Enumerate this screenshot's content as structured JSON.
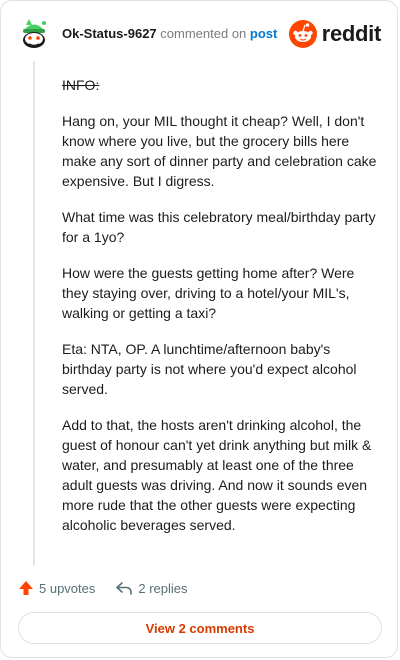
{
  "comment": {
    "author": "Ok-Status-9627",
    "action_text": "commented on",
    "post_link": "post",
    "avatar_icon": "snoo-avatar-icon",
    "brand_word": "reddit",
    "brand_color": "#ff4500",
    "paragraphs": [
      "INFO:",
      "Hang on, your MIL thought it cheap? Well, I don't know where you live, but the grocery bills here make any sort of dinner party and celebration cake expensive. But I digress.",
      "What time was this celebratory meal/birthday party for a 1yo?",
      "How were the guests getting home after? Were they staying over, driving to a hotel/your MIL's, walking or getting a taxi?",
      "Eta: NTA, OP. A lunchtime/afternoon baby's birthday party is not where you'd expect alcohol served.",
      "Add to that, the hosts aren't drinking alcohol, the guest of honour can't yet drink anything but milk & water, and presumably at least one of the three adult guests was driving. And now it sounds even more rude that the other guests were expecting alcoholic beverages served."
    ]
  },
  "actions": {
    "upvotes": "5 upvotes",
    "replies": "2 replies",
    "view_comments": "View 2 comments"
  }
}
